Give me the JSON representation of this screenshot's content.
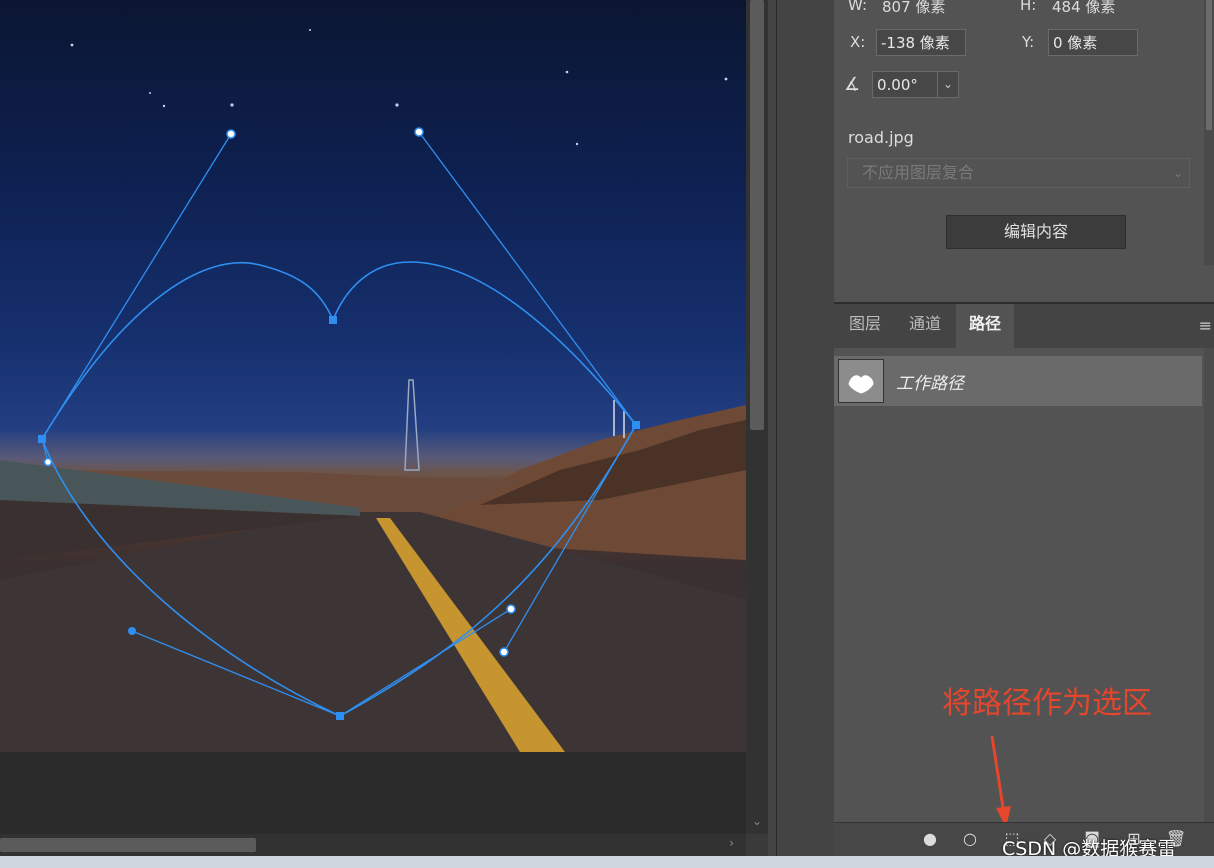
{
  "properties": {
    "w_label": "W:",
    "w_value": "807 像素",
    "h_label": "H:",
    "h_value": "484 像素",
    "x_label": "X:",
    "x_value": "-138 像素",
    "y_label": "Y:",
    "y_value": "0 像素",
    "angle_value": "0.00°",
    "file_name": "road.jpg",
    "layer_comp_select": "不应用图层复合",
    "edit_contents_button": "编辑内容"
  },
  "panel_tabs": [
    {
      "label": "图层"
    },
    {
      "label": "通道"
    },
    {
      "label": "路径"
    }
  ],
  "active_tab": "路径",
  "paths": [
    {
      "name": "工作路径"
    }
  ],
  "annotation": "将路径作为选区",
  "watermark": "CSDN @数据猴赛雷",
  "colors": {
    "path_stroke": "#2f8ff0",
    "annotation": "#e5462c",
    "panel_bg": "#535353"
  },
  "bottom_icons": [
    "fill-path-icon",
    "stroke-path-icon",
    "load-selection-icon",
    "make-work-path-icon",
    "add-mask-icon",
    "new-path-icon",
    "delete-path-icon"
  ]
}
